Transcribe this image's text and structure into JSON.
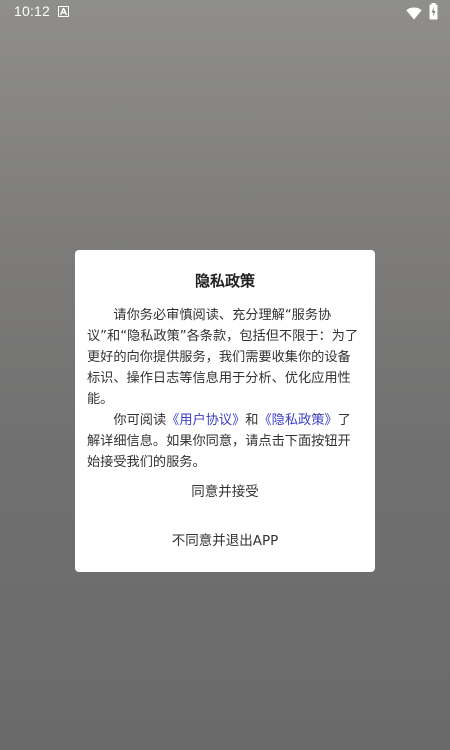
{
  "status_bar": {
    "time": "10:12",
    "notification_icon": "a-notification-icon",
    "wifi_icon": "wifi-icon",
    "battery_icon": "battery-icon"
  },
  "dialog": {
    "title": "隐私政策",
    "para1": "请你务必审慎阅读、充分理解“服务协议”和“隐私政策”各条款，包括但不限于：为了更好的向你提供服务，我们需要收集你的设备标识、操作日志等信息用于分析、优化应用性能。",
    "para2_prefix": "你可阅读",
    "user_agreement_link": "《用户协议》",
    "para2_and": "和",
    "privacy_policy_link": "《隐私政策》",
    "para2_suffix": "了解详细信息。如果你同意，请点击下面按钮开始接受我们的服务。",
    "agree_button": "同意并接受",
    "disagree_button": "不同意并退出APP"
  },
  "colors": {
    "link": "#3a3fc4",
    "dialog_bg": "#ffffff",
    "text": "#333333"
  }
}
